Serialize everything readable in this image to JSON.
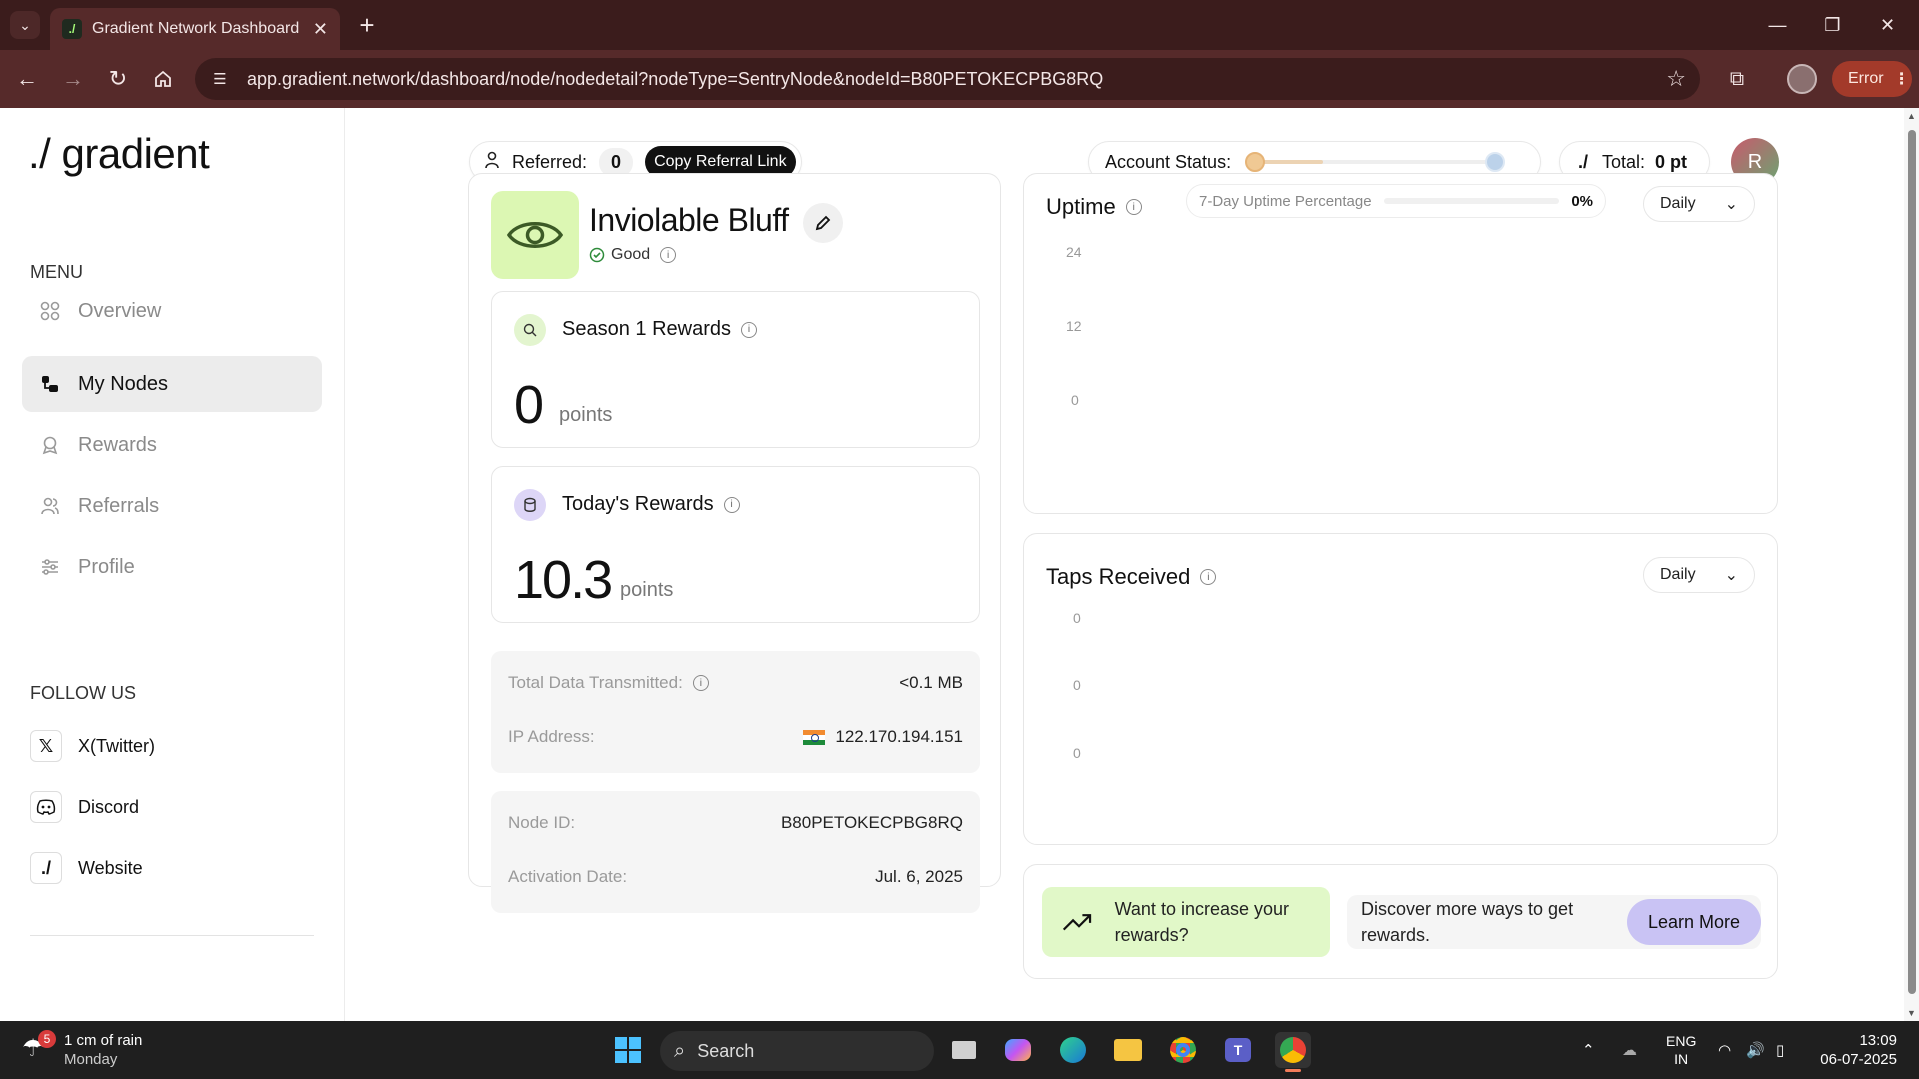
{
  "browser": {
    "tab_title": "Gradient Network Dashboard",
    "favicon_text": "./",
    "url": "app.gradient.network/dashboard/node/nodedetail?nodeType=SentryNode&nodeId=B80PETOKECPBG8RQ",
    "error_label": "Error"
  },
  "sidebar": {
    "logo": "./ gradient",
    "menu_title": "MENU",
    "items": [
      {
        "label": "Overview",
        "icon": "grid-icon"
      },
      {
        "label": "My Nodes",
        "icon": "nodes-icon"
      },
      {
        "label": "Rewards",
        "icon": "award-icon"
      },
      {
        "label": "Referrals",
        "icon": "users-icon"
      },
      {
        "label": "Profile",
        "icon": "sliders-icon"
      }
    ],
    "follow_title": "FOLLOW US",
    "social": [
      {
        "label": "X(Twitter)",
        "icon": "x-icon"
      },
      {
        "label": "Discord",
        "icon": "discord-icon"
      },
      {
        "label": "Website",
        "icon": "gradient-icon"
      }
    ]
  },
  "header": {
    "referred_label": "Referred:",
    "referred_count": "0",
    "copy_referral": "Copy Referral Link",
    "account_status_label": "Account Status:",
    "account_status_progress": 0.3,
    "total_label": "Total:",
    "total_value": "0 pt",
    "total_icon": "./",
    "avatar_initial": "R"
  },
  "node": {
    "name": "Inviolable Bluff",
    "status": "Good",
    "season_rewards_title": "Season 1 Rewards",
    "season_rewards_value": "0",
    "season_rewards_unit": "points",
    "today_rewards_title": "Today's Rewards",
    "today_rewards_value": "10.3",
    "today_rewards_unit": "points",
    "total_data_label": "Total Data Transmitted:",
    "total_data_value": "<0.1 MB",
    "ip_label": "IP Address:",
    "ip_value": "122.170.194.151",
    "node_id_label": "Node ID:",
    "node_id_value": "B80PETOKECPBG8RQ",
    "activation_label": "Activation Date:",
    "activation_value": "Jul. 6, 2025"
  },
  "uptime": {
    "title": "Uptime",
    "pill_label": "7-Day Uptime Percentage",
    "pill_value": "0%",
    "pill_fill": 0,
    "period": "Daily",
    "ticks": [
      "24",
      "12",
      "0"
    ]
  },
  "taps": {
    "title": "Taps Received",
    "period": "Daily",
    "ticks": [
      "0",
      "0",
      "0"
    ]
  },
  "promo": {
    "left_text": "Want to increase your rewards?",
    "right_text": "Discover more ways to get rewards.",
    "button": "Learn More"
  },
  "taskbar": {
    "weather_text": "1 cm of rain",
    "weather_day": "Monday",
    "weather_badge": "5",
    "search": "Search",
    "lang": "ENG",
    "region": "IN",
    "time": "13:09",
    "date": "06-07-2025"
  }
}
